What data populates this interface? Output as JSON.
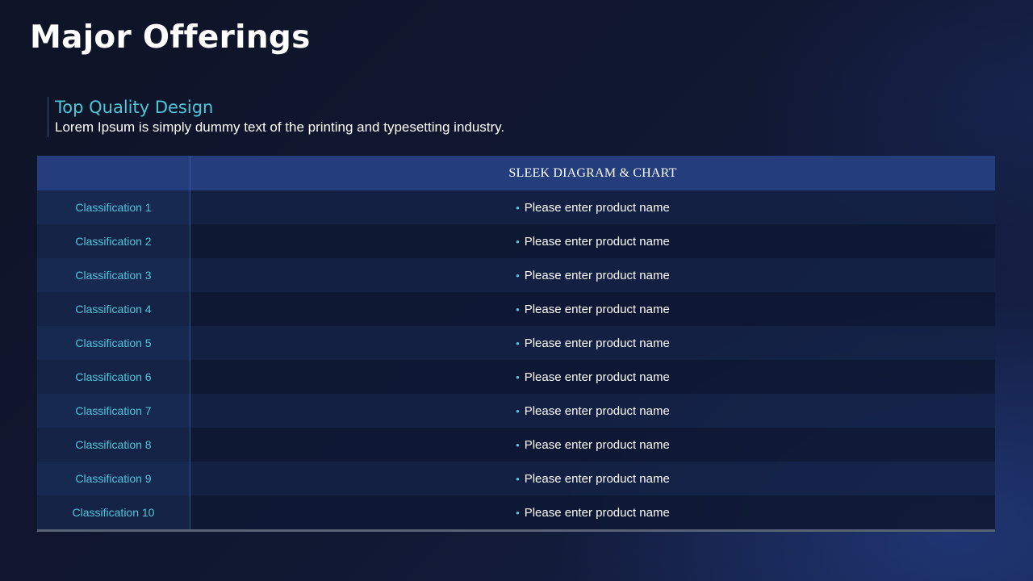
{
  "slide": {
    "title": "Major Offerings"
  },
  "subtitle": {
    "heading": "Top Quality Design",
    "text": "Lorem Ipsum is simply dummy text of the printing and typesetting industry."
  },
  "table": {
    "header_corner": "",
    "header": "SLEEK DIAGRAM & CHART",
    "rows": [
      {
        "classification": "Classification 1",
        "bullet": "•",
        "product": "Please enter product name"
      },
      {
        "classification": "Classification 2",
        "bullet": "•",
        "product": "Please enter product name"
      },
      {
        "classification": "Classification 3",
        "bullet": "•",
        "product": "Please enter product name"
      },
      {
        "classification": "Classification 4",
        "bullet": "•",
        "product": "Please enter product name"
      },
      {
        "classification": "Classification 5",
        "bullet": "•",
        "product": "Please enter product name"
      },
      {
        "classification": "Classification 6",
        "bullet": "•",
        "product": "Please enter product name"
      },
      {
        "classification": "Classification 7",
        "bullet": "•",
        "product": "Please enter product name"
      },
      {
        "classification": "Classification 8",
        "bullet": "•",
        "product": "Please enter product name"
      },
      {
        "classification": "Classification 9",
        "bullet": "•",
        "product": "Please enter product name"
      },
      {
        "classification": "Classification 10",
        "bullet": "•",
        "product": "Please enter product name"
      }
    ]
  },
  "colors": {
    "accent": "#4fc7d9",
    "header_bg": "#233d7d",
    "background": "#111833"
  }
}
